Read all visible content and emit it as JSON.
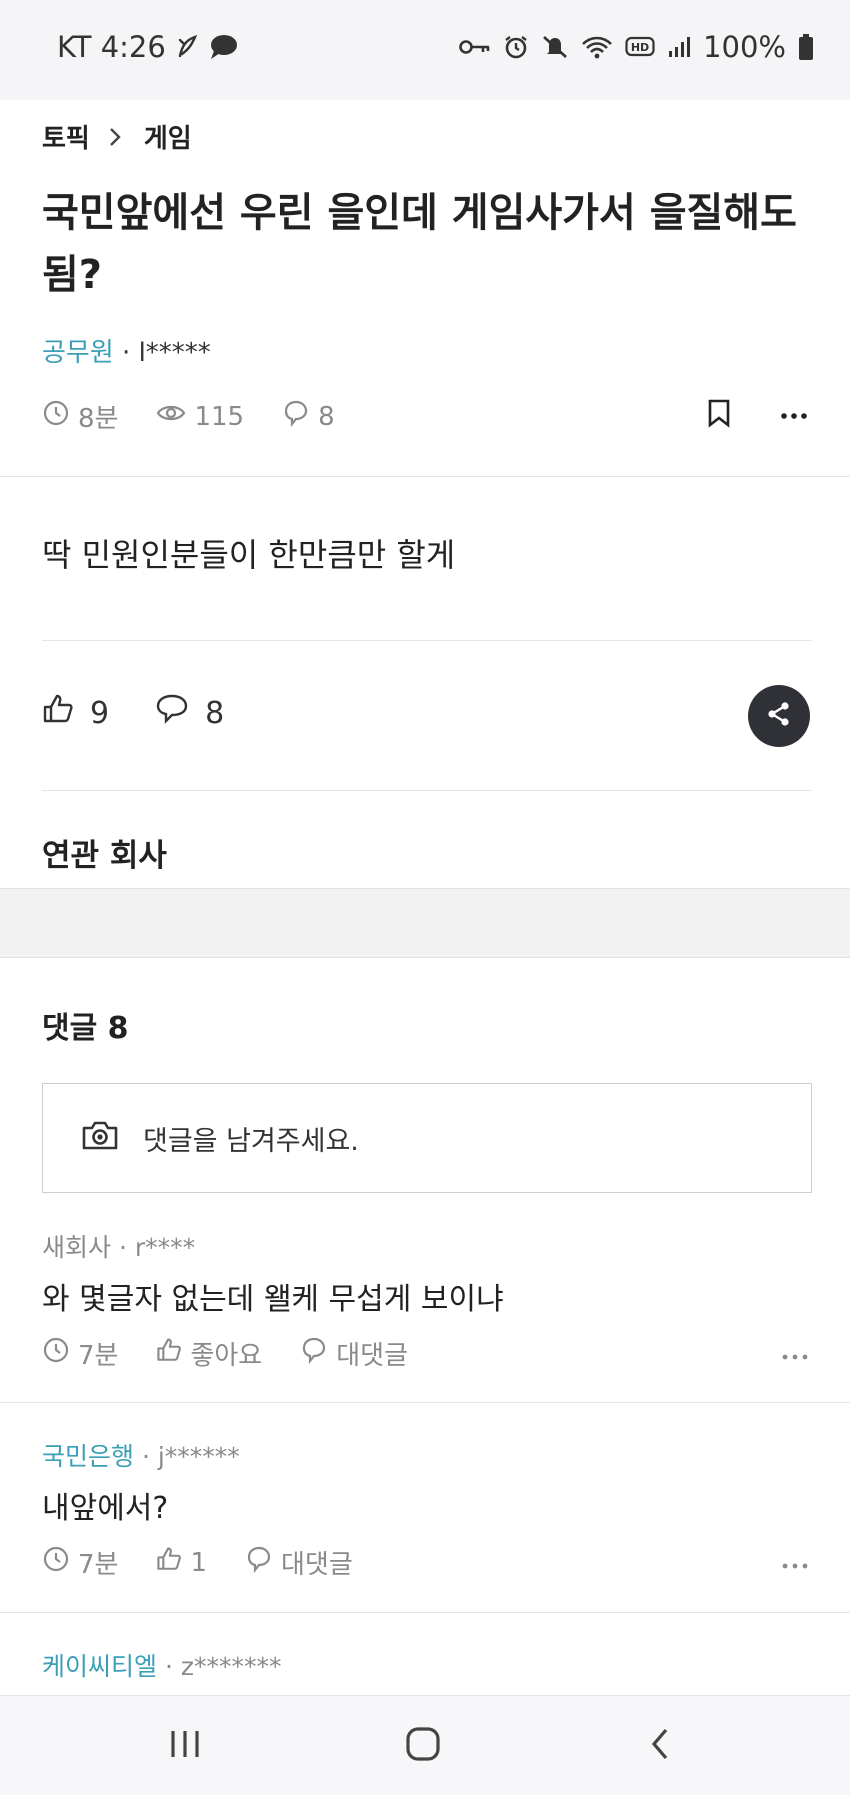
{
  "status_bar": {
    "carrier_time": "KT 4:26",
    "battery": "100%",
    "icons_left": [
      "leaf-icon",
      "chat-bubble-icon"
    ],
    "icons_right": [
      "key-icon",
      "alarm-icon",
      "mute-icon",
      "wifi-icon",
      "hd-icon",
      "signal-icon",
      "battery-icon"
    ]
  },
  "breadcrumb": {
    "root": "토픽",
    "current": "게임"
  },
  "post": {
    "title": "국민앞에선 우린 을인데 게임사가서 을질해도 됨?",
    "author_company": "공무원",
    "author_sep": " · ",
    "author_id": "l*****",
    "time": "8분",
    "views": "115",
    "comments": "8",
    "body": "딱 민원인분들이 한만큼만 할게",
    "likes": "9",
    "comment_count": "8"
  },
  "related": {
    "title": "연관 회사"
  },
  "comments_section": {
    "title": "댓글 8",
    "input_placeholder": "댓글을 남겨주세요.",
    "items": [
      {
        "company": "새회사",
        "sep": " · ",
        "user": "r****",
        "text": "와 몇글자 없는데 왤케 무섭게 보이냐",
        "time": "7분",
        "like_label": "좋아요",
        "reply_label": "대댓글",
        "company_is_link": false
      },
      {
        "company": "국민은행",
        "sep": " · ",
        "user": "j******",
        "text": "내앞에서?",
        "time": "7분",
        "like_label": "1",
        "reply_label": "대댓글",
        "company_is_link": true
      },
      {
        "company": "케이씨티엘",
        "sep": " · ",
        "user": "z*******",
        "company_is_link": true
      }
    ]
  },
  "colors": {
    "accent": "#3a9fb7",
    "share_button": "#2f3136",
    "meta_gray": "#8a8a8a"
  }
}
